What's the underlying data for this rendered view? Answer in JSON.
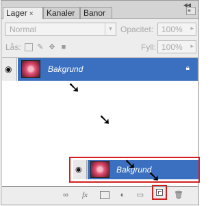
{
  "tabs": [
    {
      "label": "Lager",
      "close": "×"
    },
    {
      "label": "Kanaler"
    },
    {
      "label": "Banor"
    }
  ],
  "panel": {
    "collapse": "◀◀",
    "menu_icon": "≡"
  },
  "blend_mode": {
    "value": "Normal"
  },
  "opacity": {
    "label": "Opacitet:",
    "value": "100%"
  },
  "lock": {
    "label": "Lås:"
  },
  "fill": {
    "label": "Fyll:",
    "value": "100%"
  },
  "layers": [
    {
      "name": "Bakgrund"
    }
  ],
  "drag_ghost": {
    "name": "Bakgrund"
  },
  "footer": {
    "link": "∞",
    "fx": "fx"
  },
  "colors": {
    "selected_layer": "#3b6fbf",
    "highlight": "#d22020"
  }
}
